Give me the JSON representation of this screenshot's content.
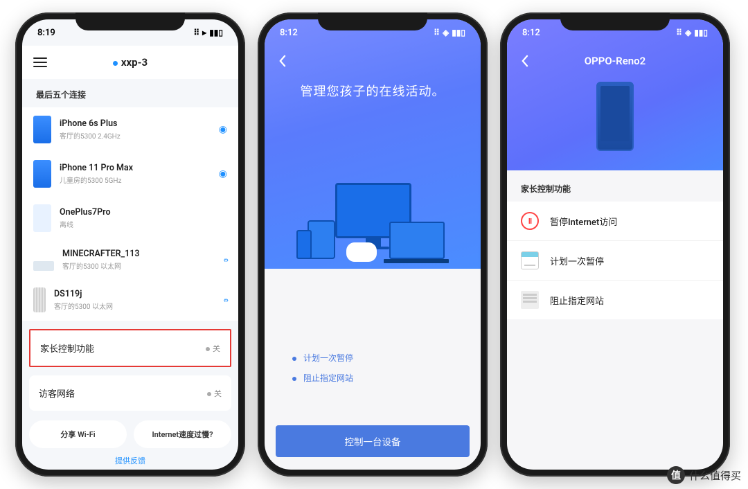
{
  "watermark": {
    "badge": "值",
    "text": "什么值得买"
  },
  "phone1": {
    "time": "8:19",
    "title": "xxp-3",
    "section_header": "最后五个连接",
    "devices": [
      {
        "name": "iPhone 6s Plus",
        "sub": "客厅的5300  2.4GHz",
        "icon": "phone-blue",
        "signal": "wifi"
      },
      {
        "name": "iPhone 11 Pro Max",
        "sub": "儿童房的5300  5GHz",
        "icon": "phone-blue",
        "signal": "wifi"
      },
      {
        "name": "OnePlus7Pro",
        "sub": "离线",
        "icon": "phone-pale",
        "signal": ""
      },
      {
        "name": "MINECRAFTER_113",
        "sub": "客厅的5300  以太网",
        "icon": "router",
        "signal": "eth"
      },
      {
        "name": "DS119j",
        "sub": "客厅的5300  以太网",
        "icon": "nas",
        "signal": "eth"
      }
    ],
    "cards": [
      {
        "name": "家长控制功能",
        "status": "关",
        "highlight": true
      },
      {
        "name": "访客网络",
        "status": "关",
        "highlight": false
      }
    ],
    "buttons": {
      "share": "分享 Wi-Fi",
      "speed": "Internet速度过慢?"
    },
    "feedback": "提供反馈"
  },
  "phone2": {
    "time": "8:12",
    "headline": "管理您孩子的在线活动。",
    "features": [
      "计划一次暂停",
      "阻止指定网站"
    ],
    "cta": "控制一台设备"
  },
  "phone3": {
    "time": "8:12",
    "title": "OPPO-Reno2",
    "section_header": "家长控制功能",
    "options": [
      {
        "label": "暂停Internet访问",
        "icon": "pause"
      },
      {
        "label": "计划一次暂停",
        "icon": "calendar"
      },
      {
        "label": "阻止指定网站",
        "icon": "news"
      }
    ]
  }
}
